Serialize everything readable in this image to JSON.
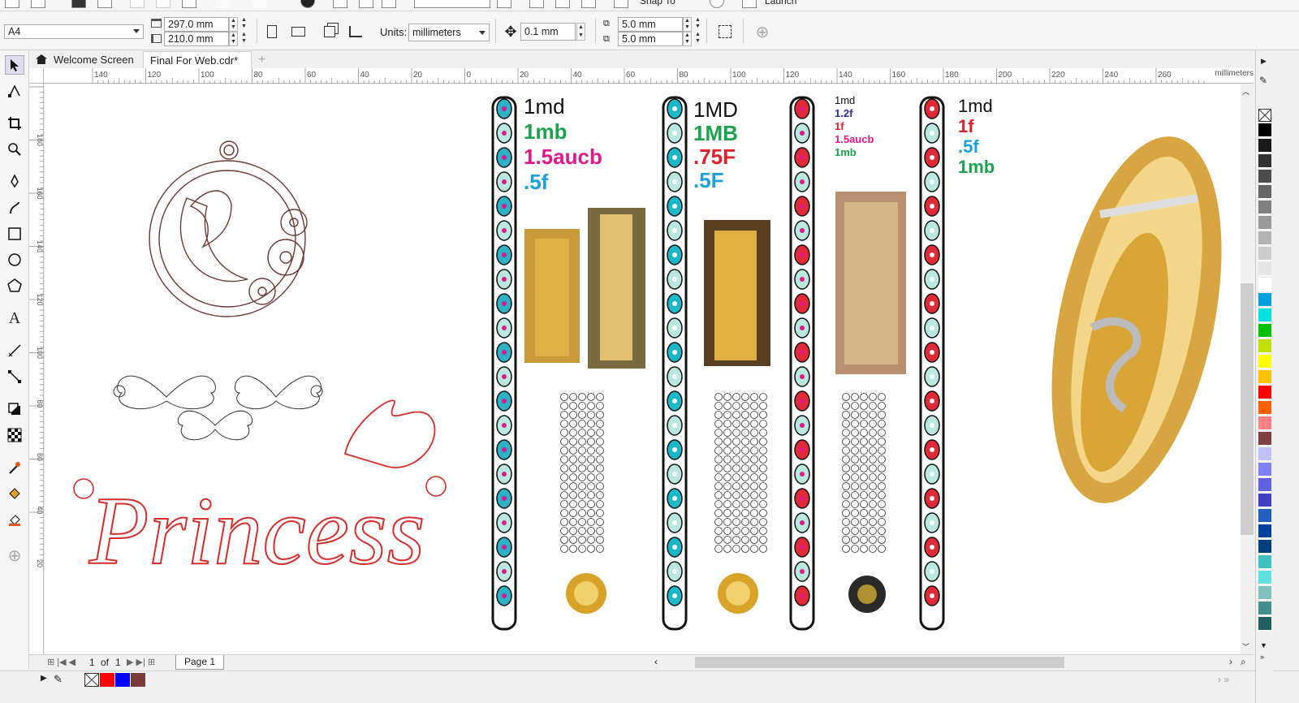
{
  "toolbar": {
    "snap_label": "Snap To",
    "launch_label": "Launch"
  },
  "property_bar": {
    "page_size": "A4",
    "width": "297.0 mm",
    "height": "210.0 mm",
    "units_label": "Units:",
    "units_value": "millimeters",
    "nudge": "0.1 mm",
    "dup_x": "5.0 mm",
    "dup_y": "5.0 mm"
  },
  "tabs": [
    {
      "label": "Welcome Screen",
      "active": false
    },
    {
      "label": "Final For Web.cdr*",
      "active": true
    }
  ],
  "ruler": {
    "h_ticks": [
      "140",
      "120",
      "100",
      "80",
      "60",
      "40",
      "20",
      "0",
      "20",
      "40",
      "60",
      "80",
      "100",
      "120",
      "140",
      "160",
      "180",
      "200",
      "220",
      "240",
      "260"
    ],
    "unit_label": "millimeters",
    "v_ticks": [
      "180",
      "160",
      "140",
      "120",
      "100",
      "80",
      "60",
      "40",
      "20"
    ]
  },
  "canvas": {
    "bangle_columns": [
      {
        "labels": [
          {
            "text": "1md",
            "color": "#111111"
          },
          {
            "text": "1mb",
            "color": "#1aa34a"
          },
          {
            "text": "1.5aucb",
            "color": "#e0198a"
          },
          {
            "text": ".5f",
            "color": "#1ea0dc"
          }
        ]
      },
      {
        "labels": [
          {
            "text": "1MD",
            "color": "#111111"
          },
          {
            "text": "1MB",
            "color": "#1aa34a"
          },
          {
            "text": ".75F",
            "color": "#e0202a"
          },
          {
            "text": ".5F",
            "color": "#1ea0dc"
          }
        ]
      },
      {
        "labels": [
          {
            "text": "1md",
            "color": "#111111"
          },
          {
            "text": "1.2f",
            "color": "#2b2e8c"
          },
          {
            "text": "1f",
            "color": "#e0202a"
          },
          {
            "text": "1.5aucb",
            "color": "#e0198a"
          },
          {
            "text": "1mb",
            "color": "#1aa34a"
          }
        ]
      },
      {
        "labels": [
          {
            "text": "1md",
            "color": "#111111"
          },
          {
            "text": "1f",
            "color": "#e0202a"
          },
          {
            "text": ".5f",
            "color": "#1ea0dc"
          },
          {
            "text": "1mb",
            "color": "#1aa34a"
          }
        ]
      }
    ],
    "princess_text": "Princess"
  },
  "page_nav": {
    "current": "1",
    "of_label": "of",
    "total": "1",
    "page_tab": "Page 1"
  },
  "palette_colors": [
    "#000000",
    "#1a1a1a",
    "#333333",
    "#4d4d4d",
    "#666666",
    "#808080",
    "#999999",
    "#b3b3b3",
    "#cccccc",
    "#e6e6e6",
    "#ffffff",
    "#00a0e0",
    "#00e0e0",
    "#00c000",
    "#c0e000",
    "#ffff00",
    "#ffc000",
    "#ff0000",
    "#ff6000",
    "#ff8080",
    "#804040",
    "#c0c0ff",
    "#8080ff",
    "#6060e0",
    "#4040c0",
    "#2060c0",
    "#0040a0",
    "#004080",
    "#40c0c0",
    "#60e0e0",
    "#80c0c0",
    "#409090",
    "#206060"
  ],
  "doc_palette": [
    "#ff0000",
    "#0000ff",
    "#7a3b3b"
  ]
}
